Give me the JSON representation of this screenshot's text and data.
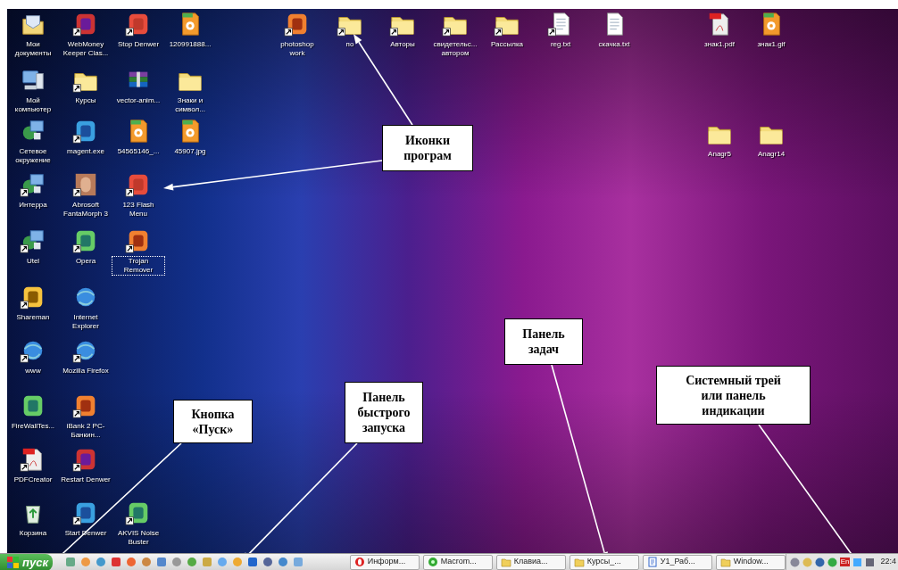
{
  "desktop_icons": [
    {
      "label": "Мои документы",
      "kind": "documents",
      "shortcut": false,
      "selected": false
    },
    {
      "label": "WebMoney Keeper Clas...",
      "kind": "app",
      "shortcut": true,
      "selected": false
    },
    {
      "label": "Stop Denwer",
      "kind": "app",
      "shortcut": true,
      "selected": false
    },
    {
      "label": "120991888...",
      "kind": "image-file",
      "shortcut": false,
      "selected": false
    },
    {
      "label": "Мой компьютер",
      "kind": "computer",
      "shortcut": false,
      "selected": false
    },
    {
      "label": "Курсы",
      "kind": "folder",
      "shortcut": true,
      "selected": false
    },
    {
      "label": "vector-anim...",
      "kind": "archive",
      "shortcut": false,
      "selected": false
    },
    {
      "label": "Знаки и символ...",
      "kind": "folder",
      "shortcut": false,
      "selected": false
    },
    {
      "label": "Сетевое окружение",
      "kind": "network",
      "shortcut": false,
      "selected": false
    },
    {
      "label": "magent.exe",
      "kind": "app",
      "shortcut": true,
      "selected": false
    },
    {
      "label": "54565146_...",
      "kind": "image-file",
      "shortcut": false,
      "selected": false
    },
    {
      "label": "45907.jpg",
      "kind": "image-file",
      "shortcut": false,
      "selected": false
    },
    {
      "label": "Интерра",
      "kind": "network",
      "shortcut": true,
      "selected": false
    },
    {
      "label": "Abrosoft FantaMorph 3",
      "kind": "photo",
      "shortcut": true,
      "selected": false
    },
    {
      "label": "123 Flash Menu",
      "kind": "app",
      "shortcut": true,
      "selected": false
    },
    {
      "label": "Utel",
      "kind": "network",
      "shortcut": true,
      "selected": false
    },
    {
      "label": "Opera",
      "kind": "app",
      "shortcut": true,
      "selected": false
    },
    {
      "label": "Trojan Remover",
      "kind": "app",
      "shortcut": true,
      "selected": true
    },
    {
      "label": "Shareman",
      "kind": "app",
      "shortcut": true,
      "selected": false
    },
    {
      "label": "Internet Explorer",
      "kind": "browser",
      "shortcut": false,
      "selected": false
    },
    {
      "label": "www",
      "kind": "browser",
      "shortcut": true,
      "selected": false
    },
    {
      "label": "Mozilla Firefox",
      "kind": "browser",
      "shortcut": true,
      "selected": false
    },
    {
      "label": "FireWallTes...",
      "kind": "app",
      "shortcut": false,
      "selected": false
    },
    {
      "label": "iBank 2 PC-Банкин...",
      "kind": "app",
      "shortcut": true,
      "selected": false
    },
    {
      "label": "PDFCreator",
      "kind": "pdf-file",
      "shortcut": true,
      "selected": false
    },
    {
      "label": "Restart Denwer",
      "kind": "app",
      "shortcut": true,
      "selected": false
    },
    {
      "label": "Корзина",
      "kind": "recycle-bin",
      "shortcut": false,
      "selected": false
    },
    {
      "label": "Start Denwer",
      "kind": "app",
      "shortcut": true,
      "selected": false
    },
    {
      "label": "AKVIS Noise Buster",
      "kind": "app",
      "shortcut": true,
      "selected": false
    },
    {
      "label": "photoshop work",
      "kind": "app",
      "shortcut": true,
      "selected": false
    },
    {
      "label": "по",
      "kind": "folder",
      "shortcut": true,
      "selected": false
    },
    {
      "label": "Авторы",
      "kind": "folder",
      "shortcut": true,
      "selected": false
    },
    {
      "label": "свидетельс... автором",
      "kind": "folder",
      "shortcut": true,
      "selected": false
    },
    {
      "label": "Рассылка",
      "kind": "folder",
      "shortcut": true,
      "selected": false
    },
    {
      "label": "reg.txt",
      "kind": "text-file",
      "shortcut": true,
      "selected": false
    },
    {
      "label": "скачка.txt",
      "kind": "text-file",
      "shortcut": false,
      "selected": false
    },
    {
      "label": "знак1.pdf",
      "kind": "pdf-file",
      "shortcut": false,
      "selected": false
    },
    {
      "label": "знак1.gif",
      "kind": "image-file",
      "shortcut": false,
      "selected": false
    },
    {
      "label": "Anagr5",
      "kind": "folder",
      "shortcut": false,
      "selected": false
    },
    {
      "label": "Anagr14",
      "kind": "folder",
      "shortcut": false,
      "selected": false
    }
  ],
  "callouts": [
    {
      "text": "Иконки\nпрограм"
    },
    {
      "text": "Кнопка\n«Пуск»"
    },
    {
      "text": "Панель\nбыстрого\nзапуска"
    },
    {
      "text": "Панель\nзадач"
    },
    {
      "text": "Системный трей\nили панель\nиндикации"
    }
  ],
  "taskbar": {
    "start_button": "пуск",
    "tasks": [
      {
        "label": "Информ...",
        "kind": "opera"
      },
      {
        "label": "Macrom...",
        "kind": "app"
      },
      {
        "label": "Клавиа...",
        "kind": "folder"
      },
      {
        "label": "Курсы_...",
        "kind": "folder"
      },
      {
        "label": "У1_Раб...",
        "kind": "document"
      },
      {
        "label": "Window...",
        "kind": "folder"
      }
    ],
    "tray": {
      "language": "En",
      "clock": "22:4"
    }
  }
}
